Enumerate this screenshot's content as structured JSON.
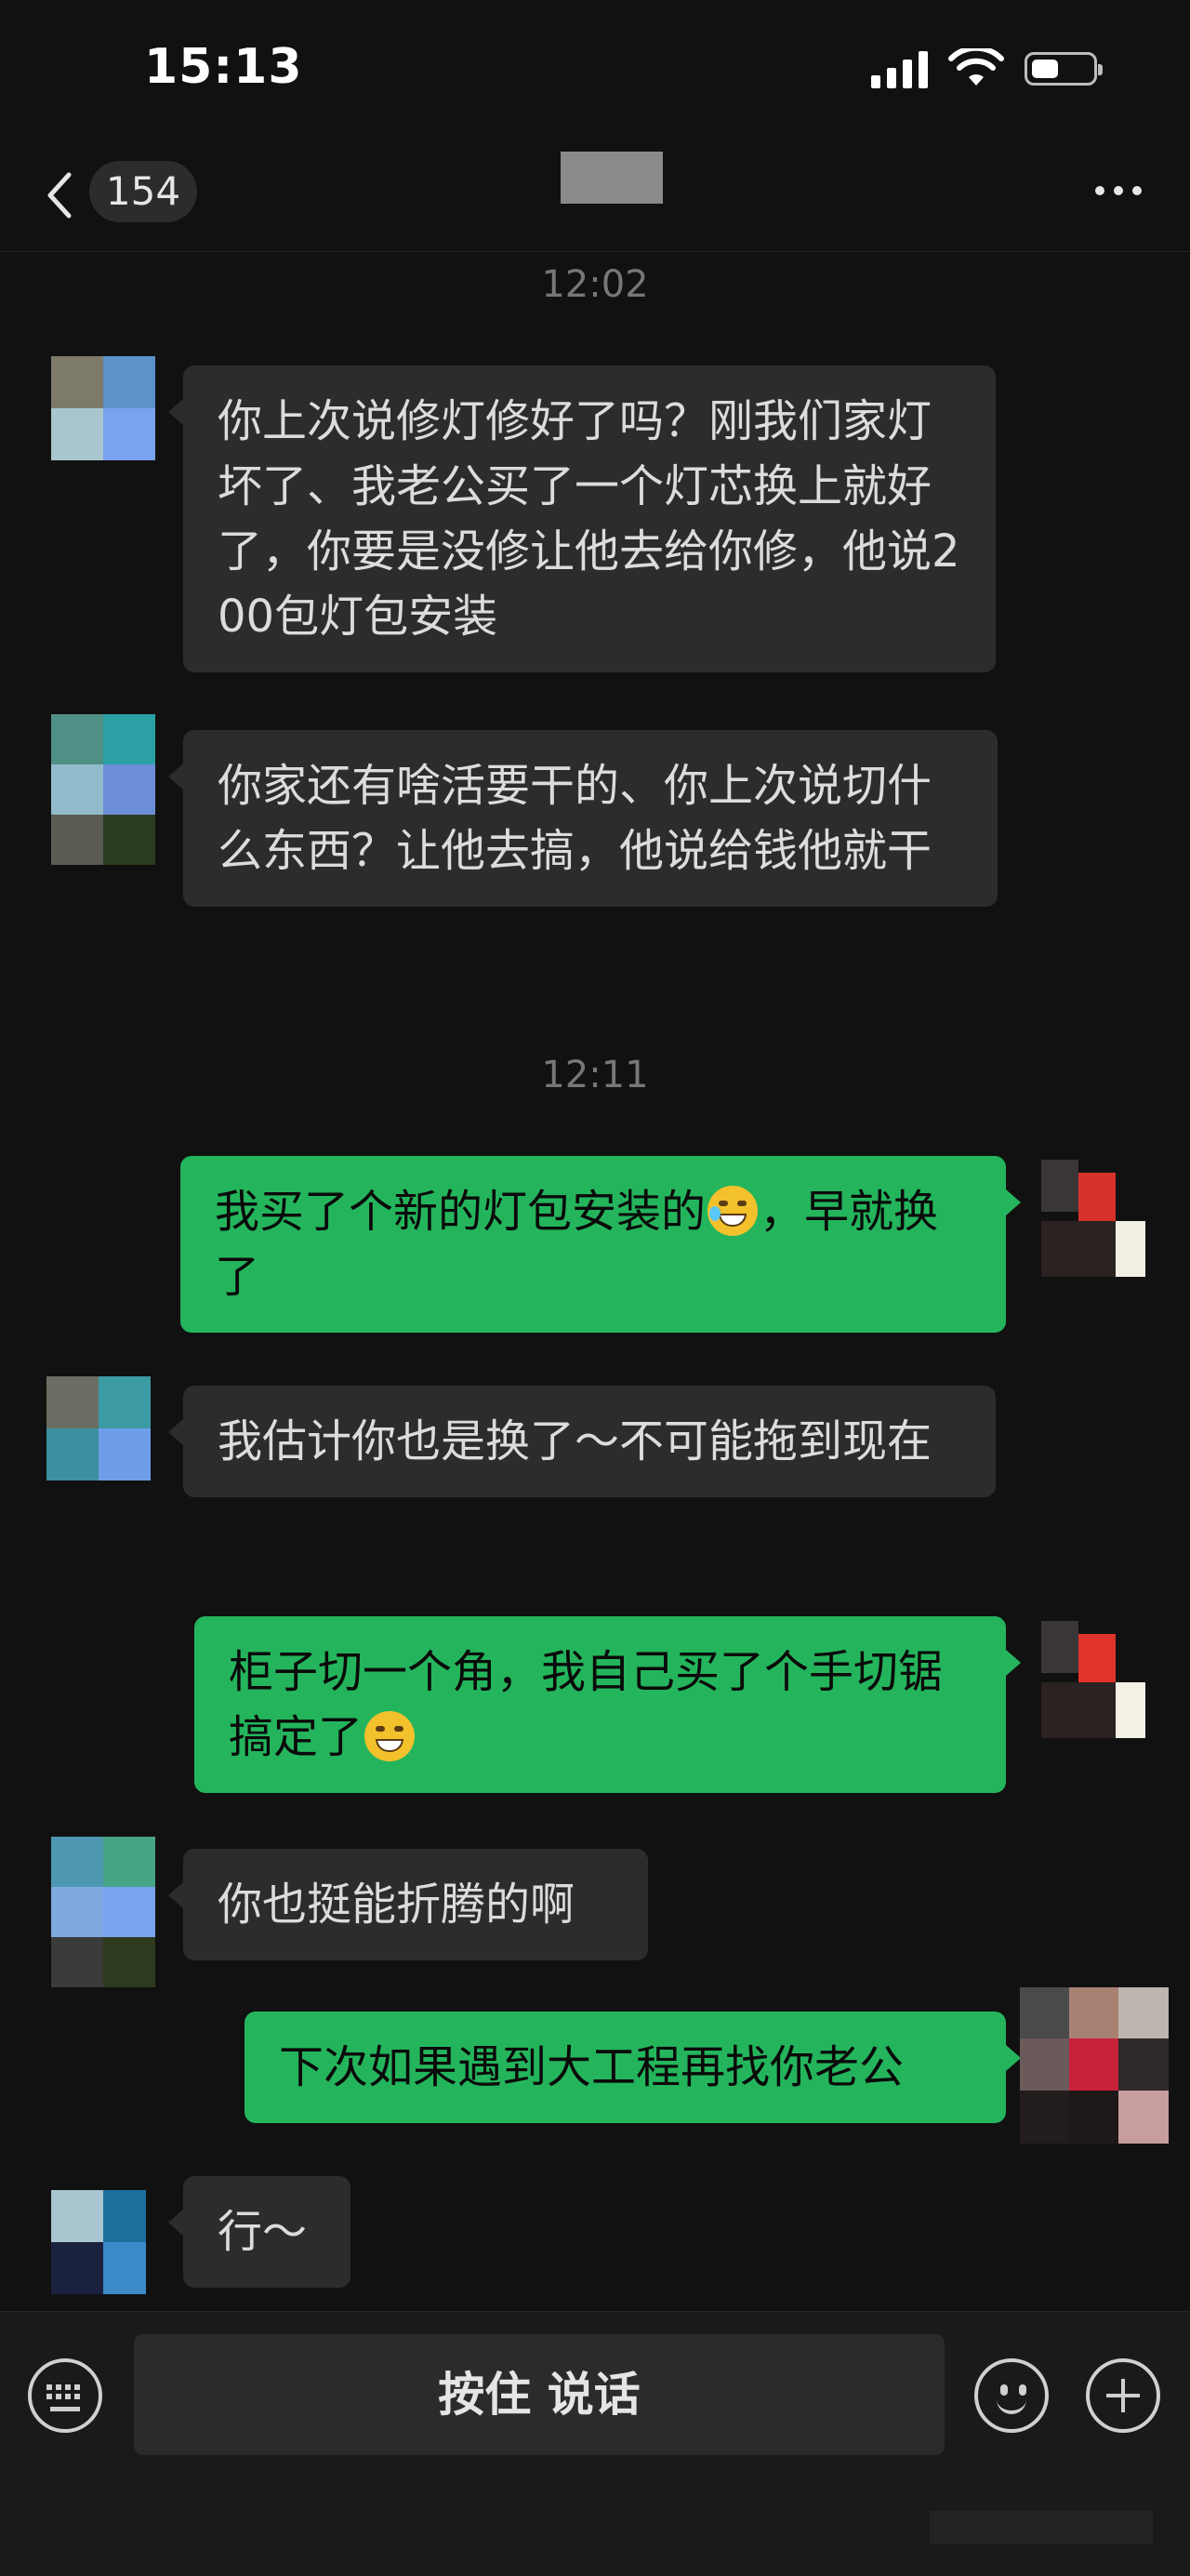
{
  "status_bar": {
    "time": "15:13",
    "signal_icon": "cellular-signal-icon",
    "wifi_icon": "wifi-icon",
    "battery_icon": "battery-icon",
    "battery_level": 0.45
  },
  "nav": {
    "back_icon": "chevron-left-icon",
    "unread_count": "154",
    "more_icon": "more-icon"
  },
  "messages": [
    {
      "type": "timestamp",
      "text": "12:02"
    },
    {
      "type": "text",
      "side": "left",
      "text": "你上次说修灯修好了吗？刚我们家灯坏了、我老公买了一个灯芯换上就好了，你要是没修让他去给你修，他说200包灯包安装"
    },
    {
      "type": "text",
      "side": "left",
      "text": "你家还有啥活要干的、你上次说切什么东西？让他去搞，他说给钱他就干"
    },
    {
      "type": "timestamp",
      "text": "12:11"
    },
    {
      "type": "text",
      "side": "right",
      "text_before": "我买了个新的灯包安装的",
      "emoji": "tears-of-joy-emoji",
      "text_after": "，早就换了"
    },
    {
      "type": "text",
      "side": "left",
      "text": "我估计你也是换了～不可能拖到现在"
    },
    {
      "type": "text",
      "side": "right",
      "text_before": "柜子切一个角，我自己买了个手切锯搞定了",
      "emoji": "grinning-emoji",
      "text_after": ""
    },
    {
      "type": "text",
      "side": "left",
      "text": "你也挺能折腾的啊"
    },
    {
      "type": "text",
      "side": "right",
      "text": "下次如果遇到大工程再找你老公"
    },
    {
      "type": "text",
      "side": "left",
      "text": "行～"
    }
  ],
  "input_bar": {
    "keyboard_icon": "keyboard-icon",
    "hold_to_talk_label": "按住 说话",
    "emoji_icon": "emoji-icon",
    "plus_icon": "plus-icon"
  }
}
